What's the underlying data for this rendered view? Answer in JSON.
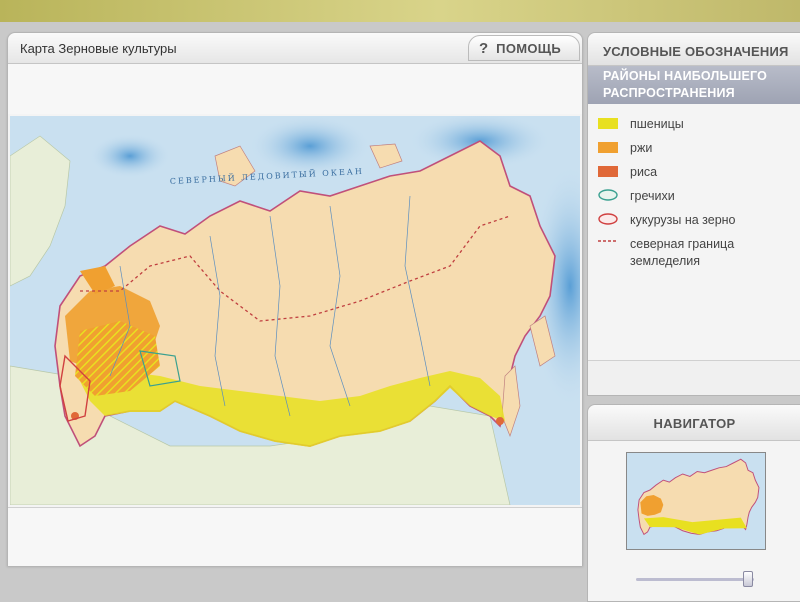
{
  "main": {
    "title": "Карта Зерновые культуры",
    "help_label": "ПОМОЩЬ",
    "help_icon": "question-mark-icon"
  },
  "map": {
    "ocean_label": "СЕВЕРНЫЙ ЛЕДОВИТЫЙ ОКЕАН"
  },
  "legend": {
    "title": "УСЛОВНЫЕ ОБОЗНАЧЕНИЯ",
    "subtitle": "РАЙОНЫ НАИБОЛЬШЕГО РАСПРОСТРАНЕНИЯ",
    "items": [
      {
        "label": "пшеницы",
        "color": "#e8e020",
        "style": "fill"
      },
      {
        "label": "ржи",
        "color": "#f0a030",
        "style": "fill"
      },
      {
        "label": "риса",
        "color": "#e06838",
        "style": "fill"
      },
      {
        "label": "гречихи",
        "color": "#3aa090",
        "style": "outline"
      },
      {
        "label": "кукурузы на зерно",
        "color": "#d04040",
        "style": "outline"
      },
      {
        "label": "северная граница земледелия",
        "color": "#c04040",
        "style": "dashed"
      }
    ]
  },
  "navigator": {
    "title": "НАВИГАТОР"
  },
  "colors": {
    "land": "#f6dcb0",
    "sea": "#c3dcee",
    "ice": "#eef4fa",
    "border": "#c0507a",
    "wheat": "#e8e020",
    "rye": "#f0a030",
    "rice": "#e06838"
  }
}
